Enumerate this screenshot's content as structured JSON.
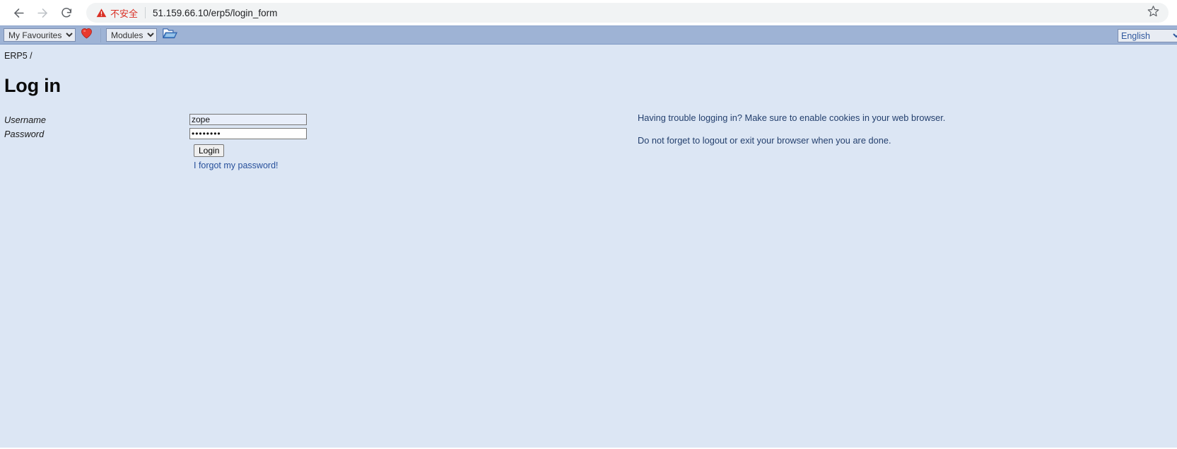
{
  "browser": {
    "back_icon": "back-arrow-icon",
    "forward_icon": "forward-arrow-icon",
    "reload_icon": "reload-icon",
    "security_warning": "不安全",
    "url": "51.159.66.10/erp5/login_form",
    "bookmark_icon": "star-icon"
  },
  "toolbar": {
    "favourites_label": "My Favourites",
    "favourites_options": [
      "My Favourites"
    ],
    "favourite_icon": "heart-icon",
    "modules_label": "Modules",
    "modules_options": [
      "Modules"
    ],
    "folder_icon": "open-folder-icon",
    "language_label": "English",
    "language_options": [
      "English"
    ]
  },
  "page": {
    "breadcrumb": "ERP5 /",
    "title": "Log in"
  },
  "form": {
    "username_label": "Username",
    "username_value": "zope",
    "password_label": "Password",
    "password_value": "zopezope",
    "login_button": "Login",
    "forgot_link": "I forgot my password!"
  },
  "help": {
    "line1": "Having trouble logging in? Make sure to enable cookies in your web browser.",
    "line2": "Do not forget to logout or exit your browser when you are done."
  },
  "colors": {
    "toolbar_blue": "#9eb3d5",
    "page_blue": "#dce6f4",
    "link_blue": "#27509b",
    "warning_red": "#d93025"
  }
}
